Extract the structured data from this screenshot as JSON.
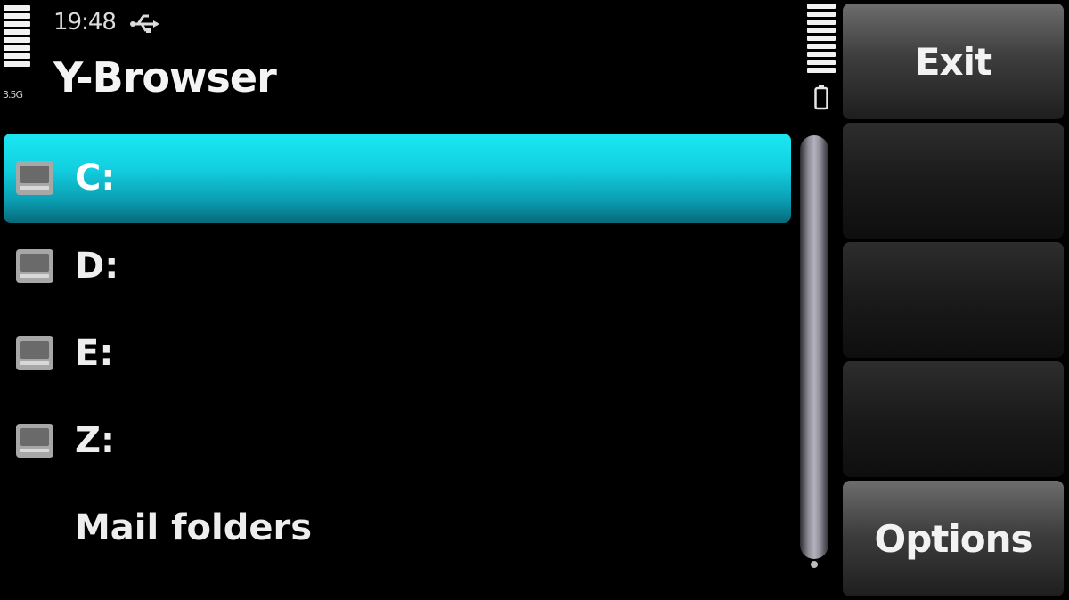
{
  "status": {
    "time": "19:48",
    "network_indicator": "3.5G",
    "connection_icon": "usb-icon",
    "signal_icon": "signal-strength-icon",
    "battery_icon": "battery-icon"
  },
  "app": {
    "title": "Y-Browser"
  },
  "list": {
    "items": [
      {
        "label": "C:",
        "icon": "drive-icon",
        "selected": true
      },
      {
        "label": "D:",
        "icon": "drive-icon",
        "selected": false
      },
      {
        "label": "E:",
        "icon": "drive-icon",
        "selected": false
      },
      {
        "label": "Z:",
        "icon": "drive-icon",
        "selected": false
      },
      {
        "label": "Mail folders",
        "icon": "",
        "selected": false
      }
    ]
  },
  "softkeys": {
    "top_label": "Exit",
    "bottom_label": "Options"
  },
  "colors": {
    "highlight": "#12cfe0",
    "background": "#000000"
  }
}
